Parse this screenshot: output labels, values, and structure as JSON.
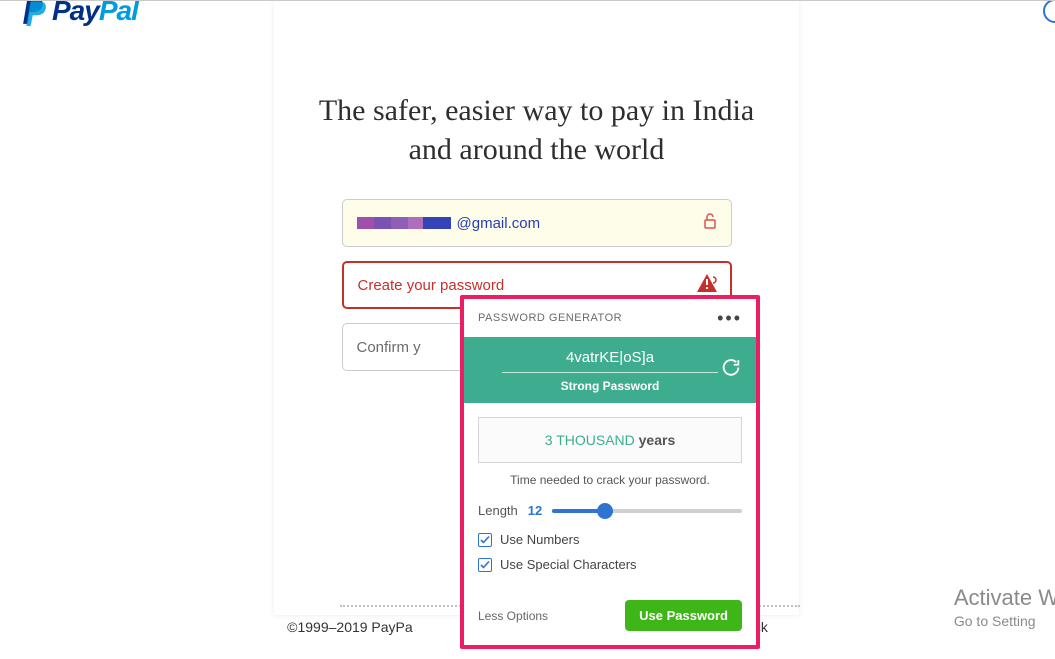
{
  "logo": {
    "text1": "Pay",
    "text2": "Pal"
  },
  "headline": "The safer, easier way to pay in India and around the world",
  "email": {
    "rest": "@gmail.com"
  },
  "password": {
    "placeholder": "Create your password"
  },
  "confirm": {
    "placeholder": "Confirm y"
  },
  "footer": {
    "copyright": "©1999–2019 PayPa",
    "feedback": "dback"
  },
  "activate": {
    "title": "Activate W",
    "sub": "Go to Setting"
  },
  "popup": {
    "title": "PASSWORD GENERATOR",
    "menu": "•••",
    "generated": "4vatrKE|oS]a",
    "strength": "Strong Password",
    "crack_value": "3 THOUSAND ",
    "crack_unit": "years",
    "crack_note": "Time needed to crack your password.",
    "length_label": "Length",
    "length_value": "12",
    "opt_numbers": "Use Numbers",
    "opt_special": "Use Special Characters",
    "less": "Less Options",
    "use": "Use Password"
  }
}
